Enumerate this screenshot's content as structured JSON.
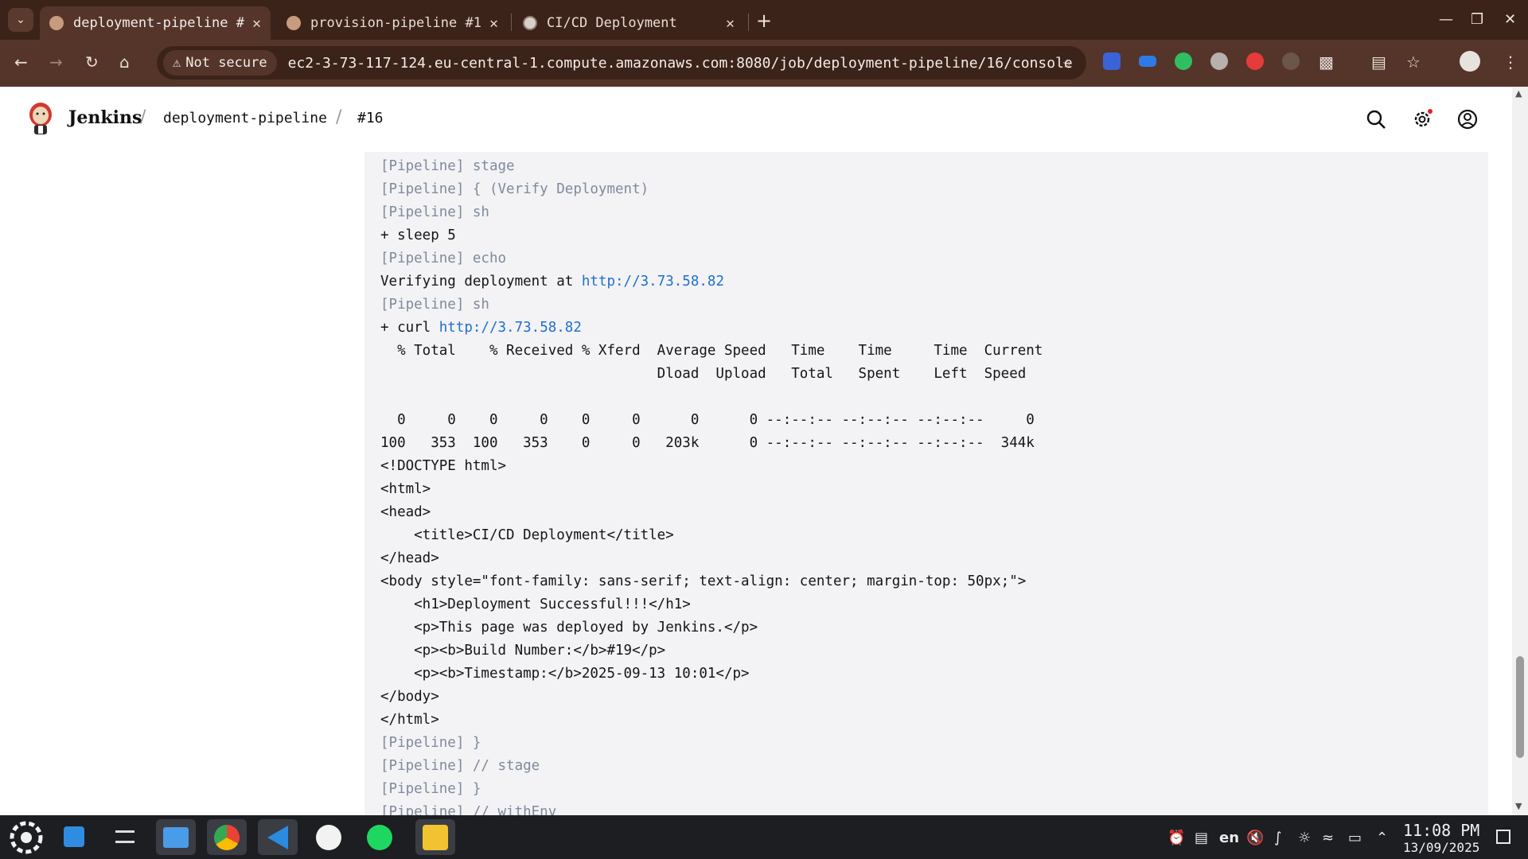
{
  "browser": {
    "tabs": [
      {
        "title": "deployment-pipeline #",
        "active": true
      },
      {
        "title": "provision-pipeline #1",
        "active": false
      },
      {
        "title": "CI/CD Deployment",
        "active": false
      }
    ],
    "new_tab": "+",
    "security_label": "Not secure",
    "url": "ec2-3-73-117-124.eu-central-1.compute.amazonaws.com:8080/job/deployment-pipeline/16/console"
  },
  "jenkins": {
    "brand": "Jenkins",
    "breadcrumbs": [
      "deployment-pipeline",
      "#16"
    ]
  },
  "console": {
    "lines": [
      {
        "text": "[Pipeline] stage",
        "kind": "pipeline"
      },
      {
        "text": "[Pipeline] { (Verify Deployment)",
        "kind": "pipeline"
      },
      {
        "text": "[Pipeline] sh",
        "kind": "pipeline"
      },
      {
        "text": "+ sleep 5",
        "kind": "out"
      },
      {
        "text": "[Pipeline] echo",
        "kind": "pipeline"
      },
      {
        "text": "Verifying deployment at ",
        "kind": "out",
        "link": "http://3.73.58.82"
      },
      {
        "text": "[Pipeline] sh",
        "kind": "pipeline"
      },
      {
        "text": "+ curl ",
        "kind": "out",
        "link": "http://3.73.58.82"
      },
      {
        "text": "  % Total    % Received % Xferd  Average Speed   Time    Time     Time  Current",
        "kind": "out"
      },
      {
        "text": "                                 Dload  Upload   Total   Spent    Left  Speed",
        "kind": "out"
      },
      {
        "text": "",
        "kind": "out"
      },
      {
        "text": "  0     0    0     0    0     0      0      0 --:--:-- --:--:-- --:--:--     0",
        "kind": "out"
      },
      {
        "text": "100   353  100   353    0     0   203k      0 --:--:-- --:--:-- --:--:--  344k",
        "kind": "out"
      },
      {
        "text": "<!DOCTYPE html>",
        "kind": "out"
      },
      {
        "text": "<html>",
        "kind": "out"
      },
      {
        "text": "<head>",
        "kind": "out"
      },
      {
        "text": "    <title>CI/CD Deployment</title>",
        "kind": "out"
      },
      {
        "text": "</head>",
        "kind": "out"
      },
      {
        "text": "<body style=\"font-family: sans-serif; text-align: center; margin-top: 50px;\">",
        "kind": "out"
      },
      {
        "text": "    <h1>Deployment Successful!!!</h1>",
        "kind": "out"
      },
      {
        "text": "    <p>This page was deployed by Jenkins.</p>",
        "kind": "out"
      },
      {
        "text": "    <p><b>Build Number:</b>#19</p>",
        "kind": "out"
      },
      {
        "text": "    <p><b>Timestamp:</b>2025-09-13 10:01</p>",
        "kind": "out"
      },
      {
        "text": "</body>",
        "kind": "out"
      },
      {
        "text": "</html>",
        "kind": "out"
      },
      {
        "text": "[Pipeline] }",
        "kind": "pipeline"
      },
      {
        "text": "[Pipeline] // stage",
        "kind": "pipeline"
      },
      {
        "text": "[Pipeline] }",
        "kind": "pipeline"
      },
      {
        "text": "[Pipeline] // withEnv",
        "kind": "pipeline"
      }
    ]
  },
  "taskbar": {
    "language": "en",
    "time": "11:08 PM",
    "date": "13/09/2025"
  },
  "colors": {
    "tabbar_bg": "#3b2319",
    "toolbar_bg": "#55352a",
    "console_bg": "#f3f3f5",
    "pipeline_text": "#7f8a9c",
    "link": "#1f6fd1"
  }
}
